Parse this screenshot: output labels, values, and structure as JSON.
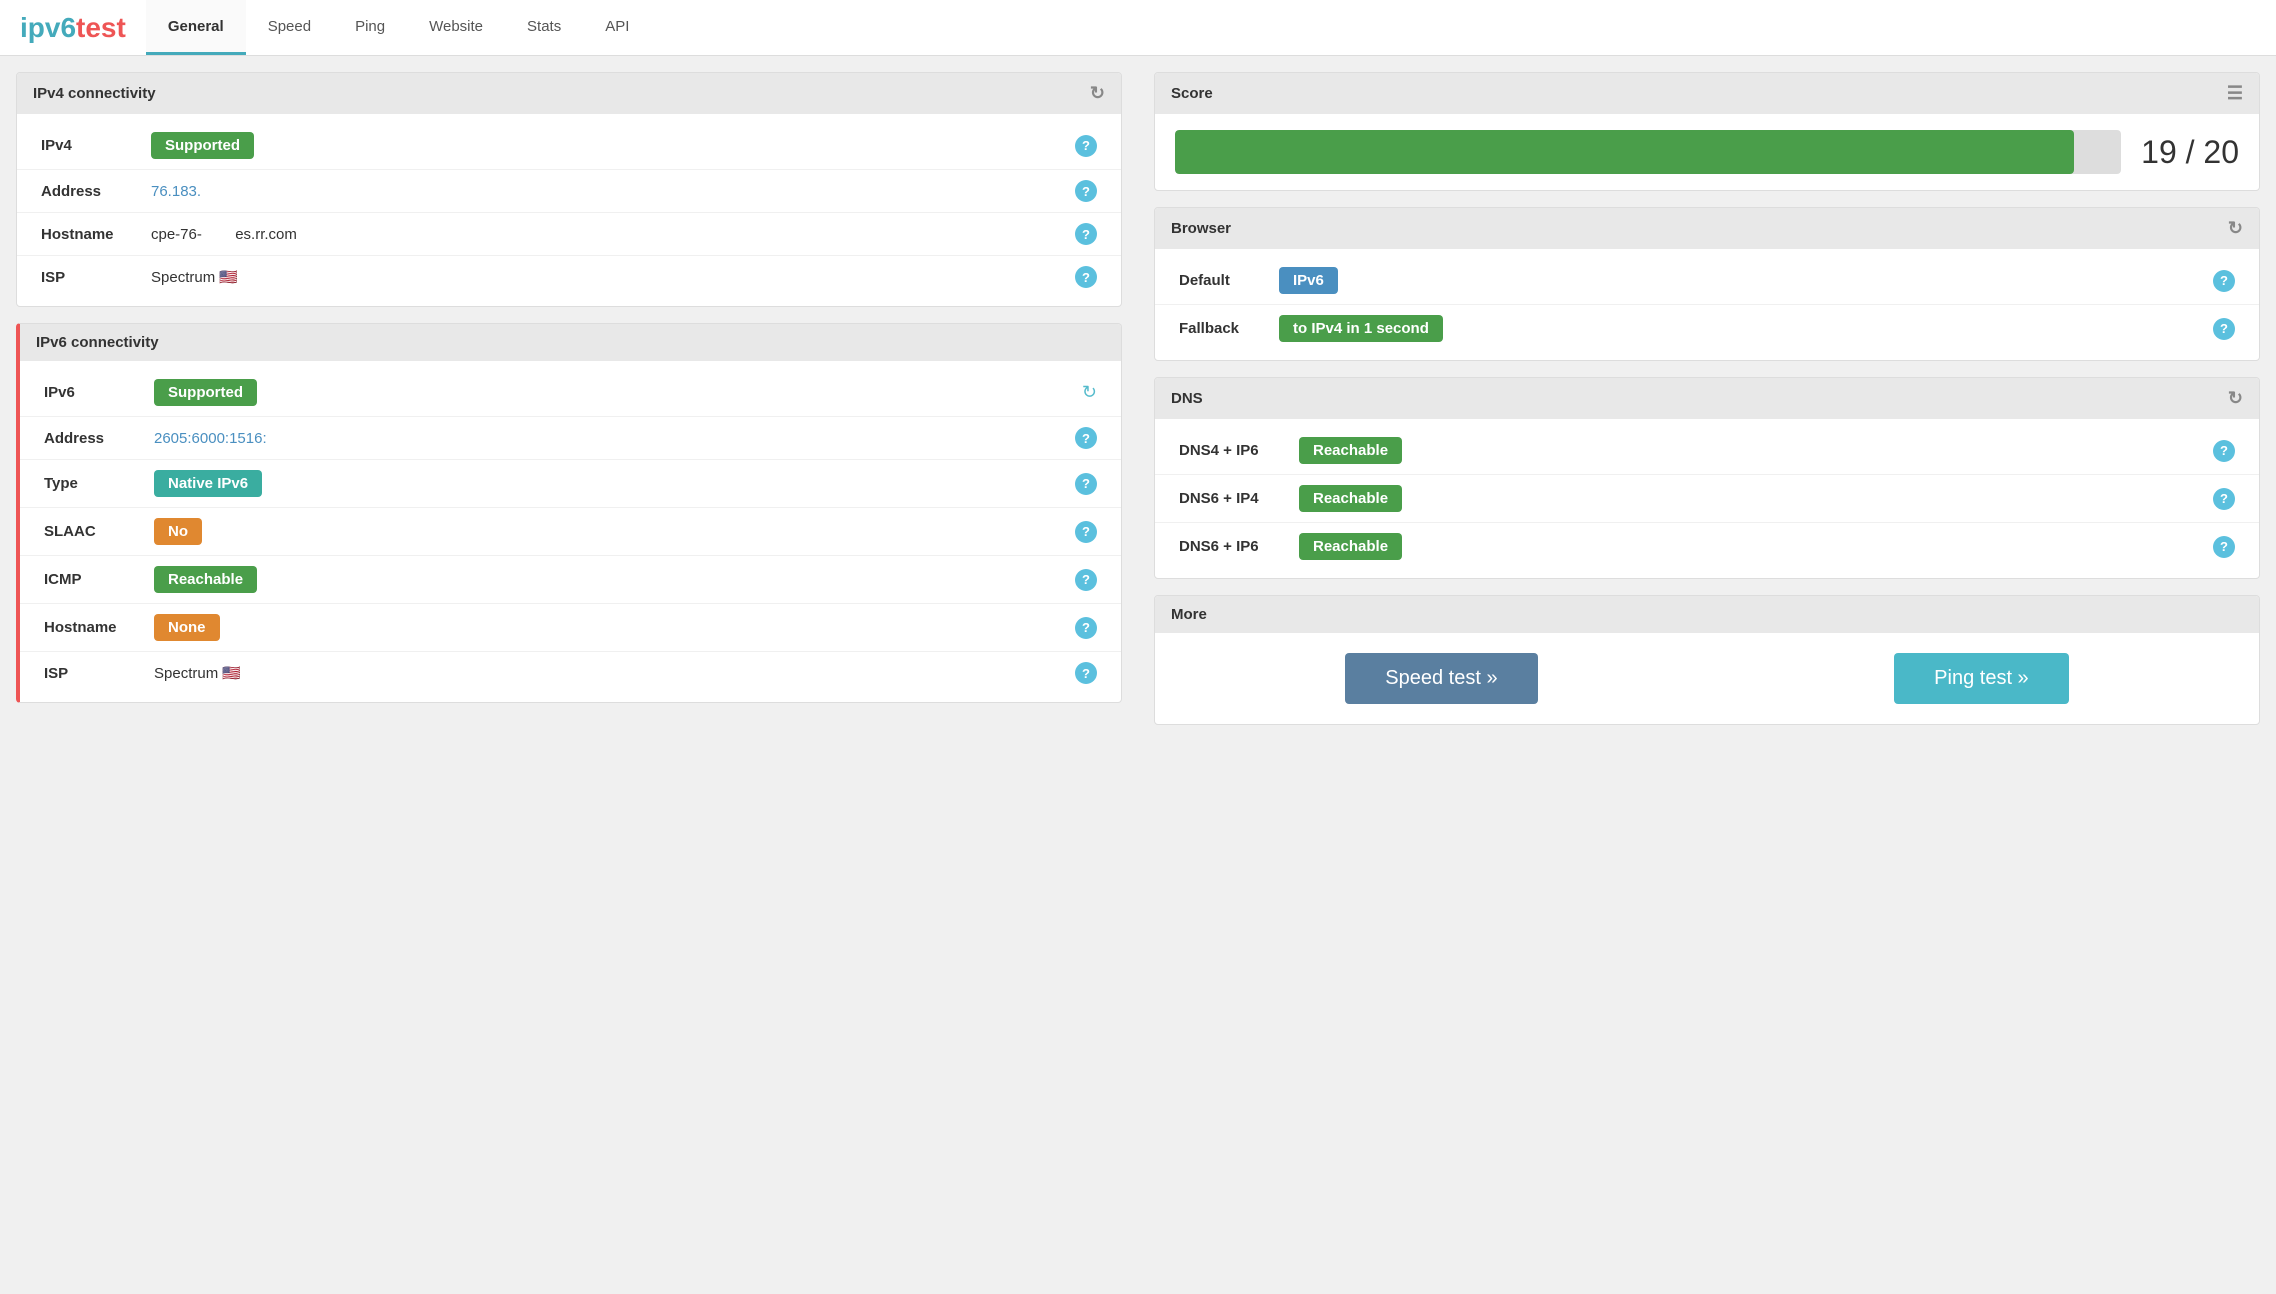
{
  "logo": {
    "part1": "ipv6",
    "part2": " test"
  },
  "nav": {
    "items": [
      {
        "label": "General",
        "active": true
      },
      {
        "label": "Speed",
        "active": false
      },
      {
        "label": "Ping",
        "active": false
      },
      {
        "label": "Website",
        "active": false
      },
      {
        "label": "Stats",
        "active": false
      },
      {
        "label": "API",
        "active": false
      }
    ]
  },
  "ipv4": {
    "section_title": "IPv4 connectivity",
    "rows": [
      {
        "label": "IPv4",
        "value": "Supported",
        "type": "badge-green"
      },
      {
        "label": "Address",
        "value": "76.183.",
        "type": "link"
      },
      {
        "label": "Hostname",
        "value": "cpe-76-",
        "value2": "es.rr.com",
        "type": "text"
      },
      {
        "label": "ISP",
        "value": "Spectrum 🇺🇸",
        "type": "text"
      }
    ]
  },
  "ipv6": {
    "section_title": "IPv6 connectivity",
    "rows": [
      {
        "label": "IPv6",
        "value": "Supported",
        "type": "badge-green"
      },
      {
        "label": "Address",
        "value": "2605:6000:1516:",
        "type": "link"
      },
      {
        "label": "Type",
        "value": "Native IPv6",
        "type": "badge-teal"
      },
      {
        "label": "SLAAC",
        "value": "No",
        "type": "badge-orange"
      },
      {
        "label": "ICMP",
        "value": "Reachable",
        "type": "badge-green"
      },
      {
        "label": "Hostname",
        "value": "None",
        "type": "badge-orange"
      },
      {
        "label": "ISP",
        "value": "Spectrum 🇺🇸",
        "type": "text"
      }
    ]
  },
  "score": {
    "title": "Score",
    "current": 19,
    "max": 20,
    "display": "19 / 20",
    "bar_pct": 95
  },
  "browser": {
    "title": "Browser",
    "rows": [
      {
        "label": "Default",
        "value": "IPv6",
        "type": "badge-blue"
      },
      {
        "label": "Fallback",
        "value": "to IPv4 in 1 second",
        "type": "badge-green"
      }
    ]
  },
  "dns": {
    "title": "DNS",
    "rows": [
      {
        "label": "DNS4 + IP6",
        "value": "Reachable",
        "type": "badge-green"
      },
      {
        "label": "DNS6 + IP4",
        "value": "Reachable",
        "type": "badge-green"
      },
      {
        "label": "DNS6 + IP6",
        "value": "Reachable",
        "type": "badge-green"
      }
    ]
  },
  "more": {
    "title": "More",
    "speed_btn": "Speed test »",
    "ping_btn": "Ping test »"
  },
  "icons": {
    "refresh": "↻",
    "list": "☰",
    "help": "?",
    "spinner": "↻"
  }
}
